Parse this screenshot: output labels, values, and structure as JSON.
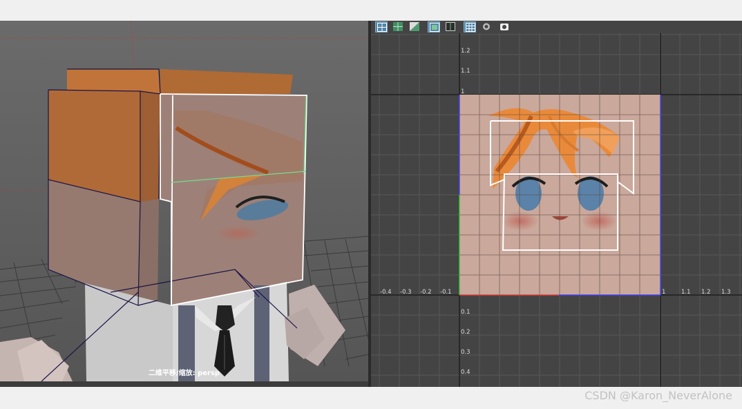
{
  "viewport": {
    "label": "二维平移/缩放: persp"
  },
  "uv_editor": {
    "y_axis_labels": [
      "1.2",
      "1.1",
      "1",
      "0.1",
      "0.2",
      "0.3",
      "0.4"
    ],
    "x_axis_labels_left": [
      "-0.4",
      "-0.3",
      "-0.2",
      "-0.1"
    ],
    "x_axis_labels_right": [
      "1",
      "1.1",
      "1.2",
      "1.3"
    ]
  },
  "toolbar": {
    "icons": [
      "uv-grid-icon",
      "uv-shaded-icon",
      "uv-texture-icon",
      "uv-frame-icon",
      "uv-layout-icon",
      "grid-toggle-icon",
      "dim-image-icon",
      "snapshot-icon"
    ]
  },
  "watermark": {
    "text": "CSDN @Karon_NeverAlone"
  },
  "colors": {
    "uv_background": "#444444",
    "face_texture": "#caa89c",
    "hair": "#e88838",
    "eye": "#5b82a8",
    "selection": "#ffffff"
  }
}
